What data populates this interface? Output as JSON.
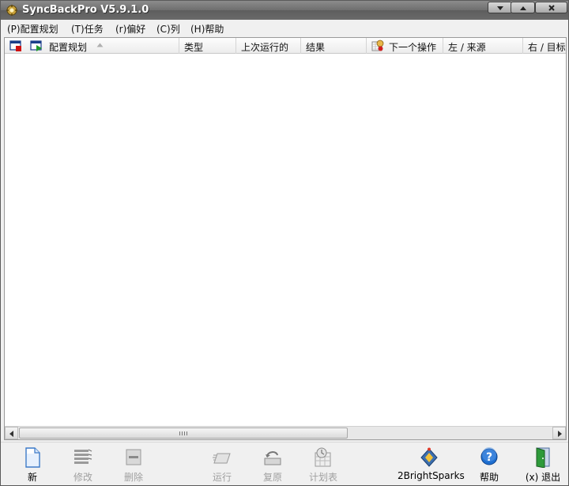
{
  "window": {
    "title": "SyncBackPro V5.9.1.0"
  },
  "menu": [
    {
      "label": "(P)配置规划"
    },
    {
      "label": "(T)任务"
    },
    {
      "label": "(r)偏好"
    },
    {
      "label": "(C)列"
    },
    {
      "label": "(H)帮助"
    }
  ],
  "columns": [
    {
      "label": "配置规划"
    },
    {
      "label": "类型"
    },
    {
      "label": "上次运行的"
    },
    {
      "label": "结果"
    },
    {
      "label": "下一个操作"
    },
    {
      "label": "左 / 来源"
    },
    {
      "label": "右 / 目标"
    }
  ],
  "toolbar": {
    "new": "新",
    "modify": "修改",
    "delete": "删除",
    "run": "运行",
    "restore": "复原",
    "schedule": "计划表",
    "brand": "2BrightSparks",
    "help": "帮助",
    "exit": "(x) 退出"
  },
  "colors": {
    "titlebar": "#6e6e6e",
    "accent_blue": "#1e6fd0",
    "exit_green": "#2e9a3a"
  }
}
